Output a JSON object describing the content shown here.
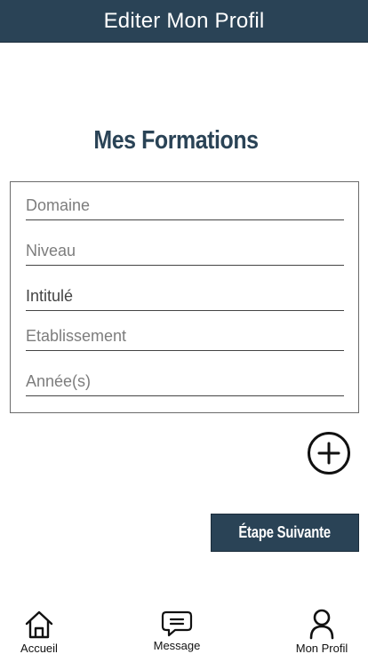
{
  "header": {
    "title": "Editer Mon Profil"
  },
  "section": {
    "title": "Mes Formations"
  },
  "form": {
    "fields": [
      {
        "placeholder": "Domaine"
      },
      {
        "placeholder": "Niveau"
      },
      {
        "placeholder": "Intitulé"
      },
      {
        "placeholder": "Etablissement"
      },
      {
        "placeholder": "Année(s)"
      }
    ]
  },
  "actions": {
    "add_icon": "plus-circle-icon",
    "next_label": "Étape Suivante"
  },
  "tabbar": {
    "items": [
      {
        "label": "Accueil",
        "icon": "home-icon"
      },
      {
        "label": "Message",
        "icon": "message-icon"
      },
      {
        "label": "Mon Profil",
        "icon": "user-icon"
      }
    ]
  },
  "colors": {
    "primary": "#2a4356"
  }
}
